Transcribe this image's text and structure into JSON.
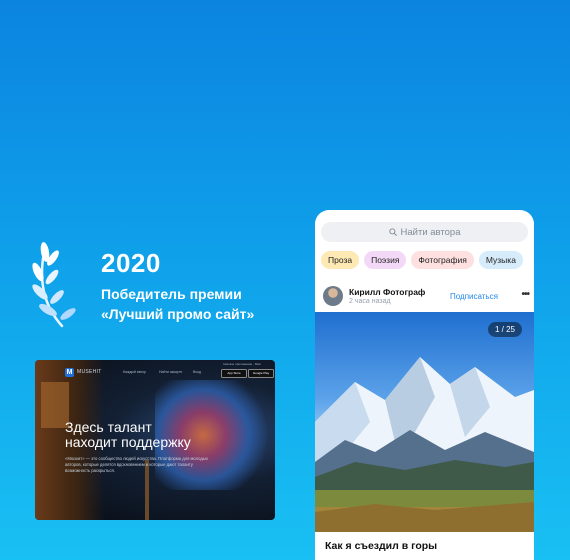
{
  "award": {
    "year": "2020",
    "line1": "Победитель премии",
    "line2": "«Лучший промо сайт»"
  },
  "website": {
    "brand": "MUSEHIT",
    "nav": [
      "Каждый автор",
      "Найти аккаунт",
      "Вход"
    ],
    "topline": "Скачать приложение · Моё",
    "stores": [
      "App Store",
      "Google Play"
    ],
    "headline_line1": "Здесь талант",
    "headline_line2": "находит поддержку",
    "description": "«Мюзхит» — это сообщество людей искусства. Платформа для молодых авторов, которые делятся вдохновением и которые дают таланту возможность раскрыться."
  },
  "phone": {
    "search_placeholder": "Найти автора",
    "chips": [
      {
        "label": "Проза",
        "color": "#fde9b3"
      },
      {
        "label": "Поэзия",
        "color": "#f3d9f7"
      },
      {
        "label": "Фотография",
        "color": "#fde0df"
      },
      {
        "label": "Музыка",
        "color": "#d7ecfb"
      }
    ],
    "post": {
      "author": "Кирилл Фотограф",
      "time": "2 часа назад",
      "subscribe_label": "Подписаться",
      "more": "•••",
      "counter": "1 / 25",
      "title": "Как я съездил в горы"
    }
  },
  "colors": {
    "accent": "#2688eb",
    "background_top": "#0b84e0",
    "background_bottom": "#19c0f3"
  }
}
